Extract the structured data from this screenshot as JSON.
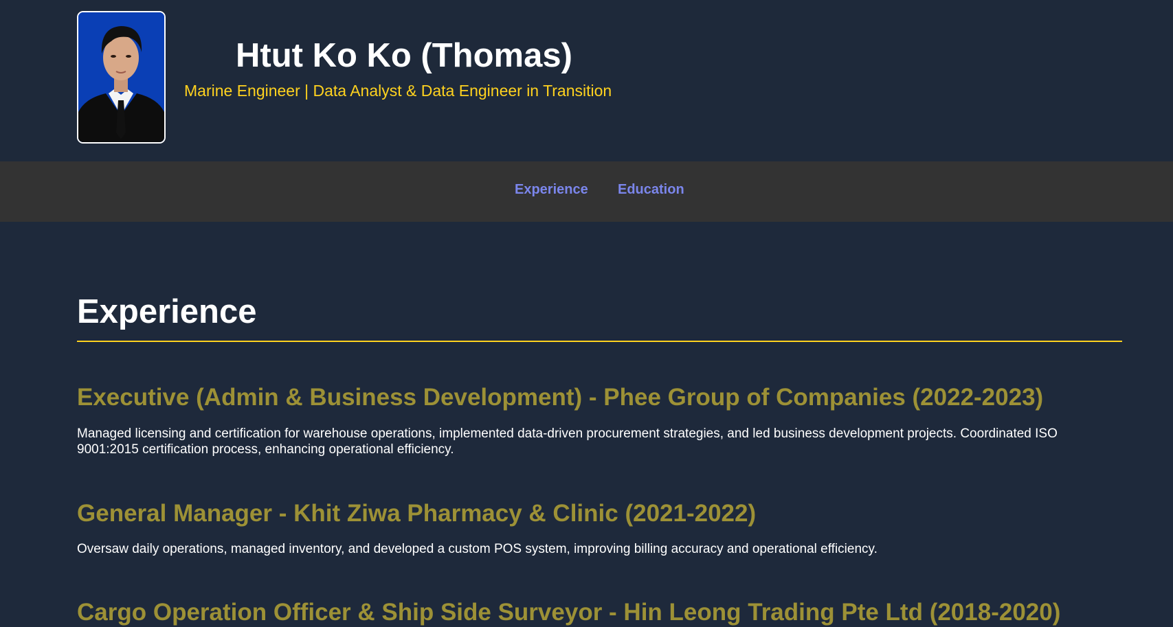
{
  "profile": {
    "name": "Htut Ko Ko (Thomas)",
    "tagline": "Marine Engineer | Data Analyst & Data Engineer in Transition"
  },
  "nav": {
    "items": [
      {
        "label": "Experience"
      },
      {
        "label": "Education"
      }
    ],
    "link_color": "#7b86ec"
  },
  "experience": {
    "heading": "Experience",
    "jobs": [
      {
        "title": "Executive (Admin & Business Development) - Phee Group of Companies (2022-2023)",
        "description": "Managed licensing and certification for warehouse operations, implemented data-driven procurement strategies, and led business development projects. Coordinated ISO 9001:2015 certification process, enhancing operational efficiency."
      },
      {
        "title": "General Manager - Khit Ziwa Pharmacy & Clinic (2021-2022)",
        "description": "Oversaw daily operations, managed inventory, and developed a custom POS system, improving billing accuracy and operational efficiency."
      },
      {
        "title": "Cargo Operation Officer & Ship Side Surveyor - Hin Leong Trading Pte Ltd (2018-2020)"
      }
    ]
  },
  "colors": {
    "background": "#1e293b",
    "accent": "#ffd21f",
    "job_title": "#9d9136",
    "nav_bar": "#333333"
  }
}
